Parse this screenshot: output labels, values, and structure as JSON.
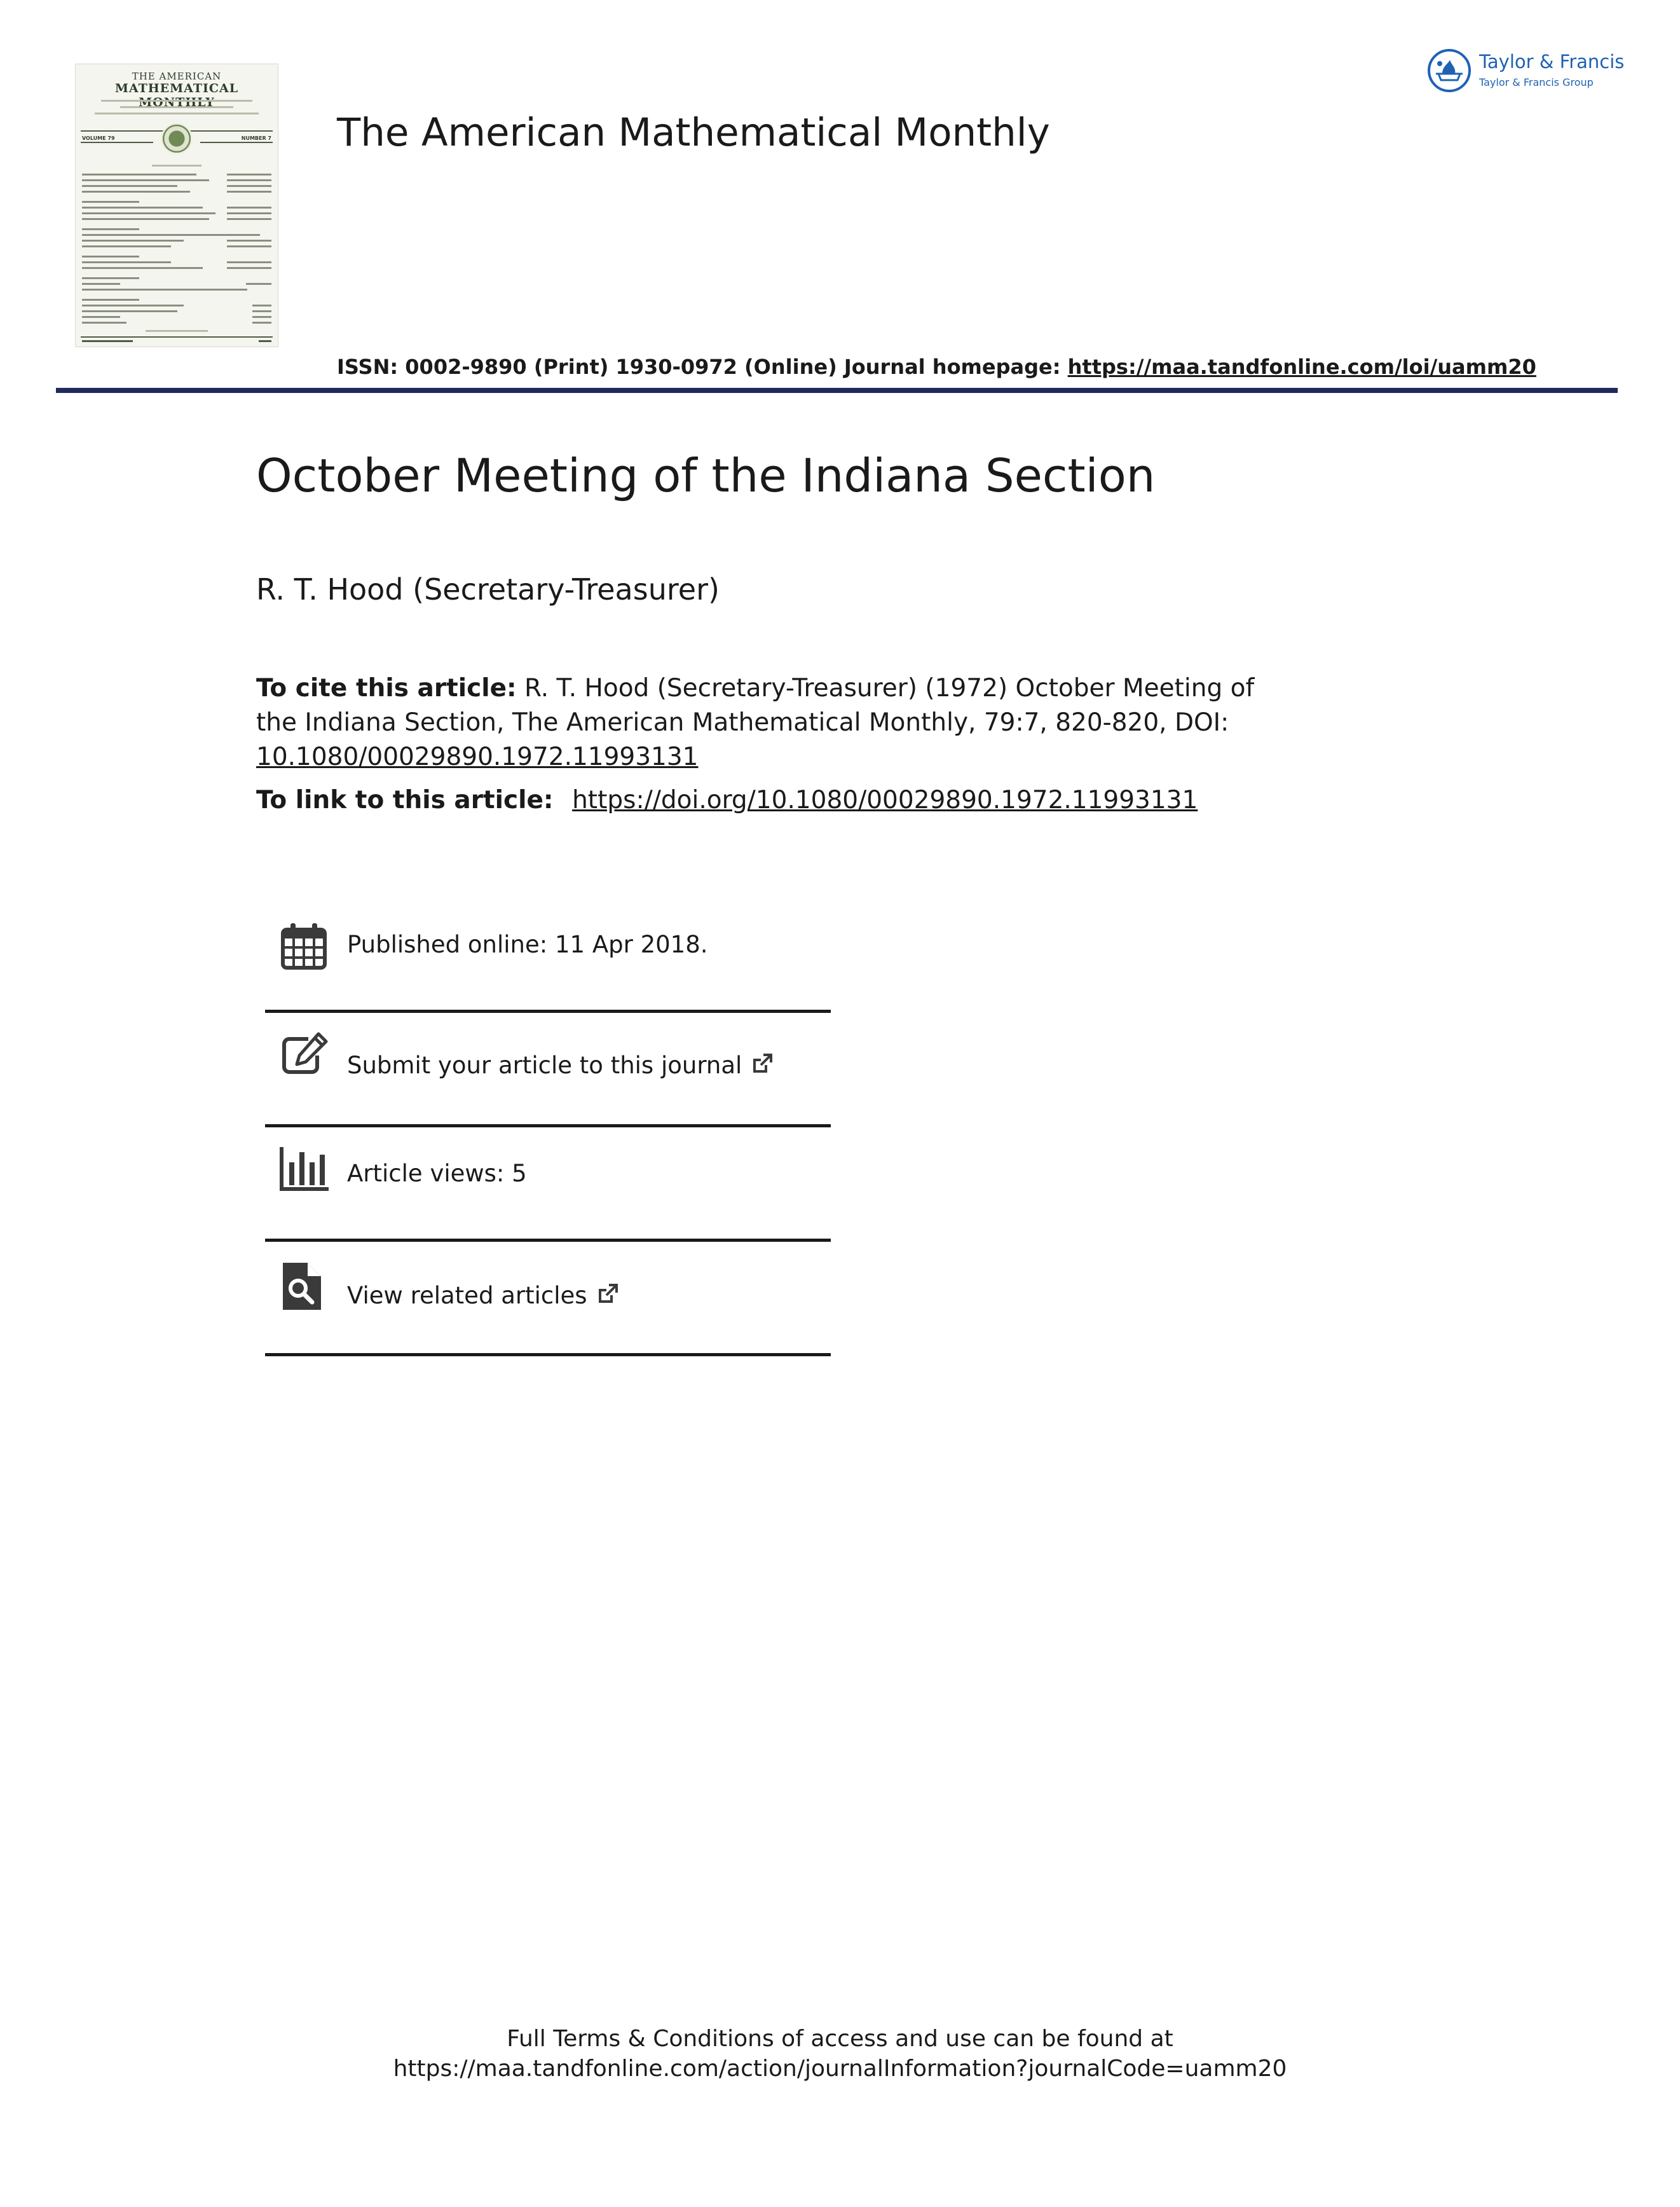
{
  "cover": {
    "title_line1": "THE AMERICAN",
    "title_line2": "MATHEMATICAL MONTHLY",
    "volume": "VOLUME 79",
    "number": "NUMBER 7"
  },
  "header": {
    "journal_name": "The American Mathematical Monthly",
    "issn_text": "ISSN: 0002-9890 (Print) 1930-0972 (Online) Journal homepage: ",
    "homepage_url": "https://maa.tandfonline.com/loi/uamm20",
    "publisher_name": "Taylor & Francis",
    "publisher_group": "Taylor & Francis Group",
    "brand_color": "#1f62b4",
    "rule_color": "#1f2a5c"
  },
  "article": {
    "title": "October Meeting of the Indiana Section",
    "author": "R. T. Hood (Secretary-Treasurer)"
  },
  "citation": {
    "label": "To cite this article:",
    "text": " R. T. Hood (Secretary-Treasurer) (1972) October Meeting of the Indiana Section, The American Mathematical Monthly, 79:7, 820-820, DOI: ",
    "doi": "10.1080/00029890.1972.11993131",
    "link_label": "To link to this article: ",
    "link_url": "https://doi.org/10.1080/00029890.1972.11993131"
  },
  "info": {
    "published": "Published online: 11 Apr 2018.",
    "submit": "Submit your article to this journal",
    "views": "Article views: 5",
    "related": "View related articles"
  },
  "icons": {
    "published": "calendar-icon",
    "submit": "edit-icon",
    "views": "bar-chart-icon",
    "related": "search-document-icon",
    "external": "external-link-icon"
  },
  "footer": {
    "line1": "Full Terms & Conditions of access and use can be found at",
    "line2": "https://maa.tandfonline.com/action/journalInformation?journalCode=uamm20"
  }
}
